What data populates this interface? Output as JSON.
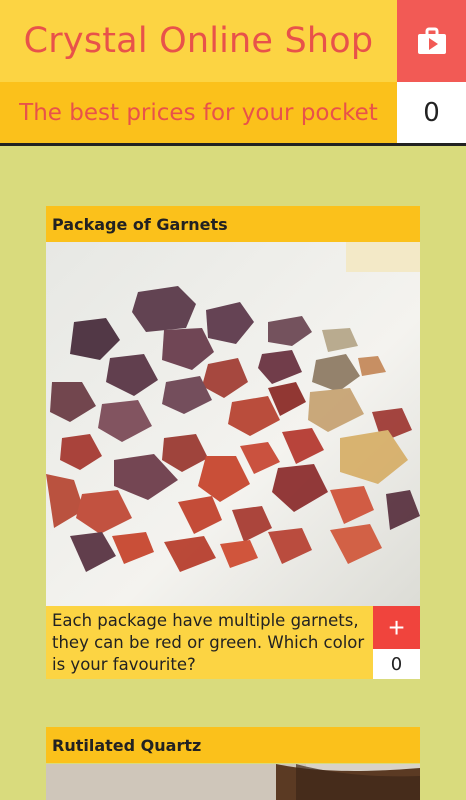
{
  "header": {
    "title": "Crystal Online Shop",
    "tagline": "The best prices for your pocket",
    "cart_count": "0",
    "cart_icon": "shopping-bag-icon",
    "colors": {
      "title_bg": "#fcd443",
      "tagline_bg": "#fbc11b",
      "accent": "#f25a55",
      "text_accent": "#e8524a"
    }
  },
  "products": [
    {
      "name": "Package of Garnets",
      "description": "Each package have multiple garnets, they can be red or green. Which color is your favourite?",
      "add_label": "+",
      "quantity": "0"
    },
    {
      "name": "Rutilated Quartz"
    }
  ],
  "colors": {
    "page_bg": "#d9db7d",
    "add_button": "#f0443d"
  }
}
